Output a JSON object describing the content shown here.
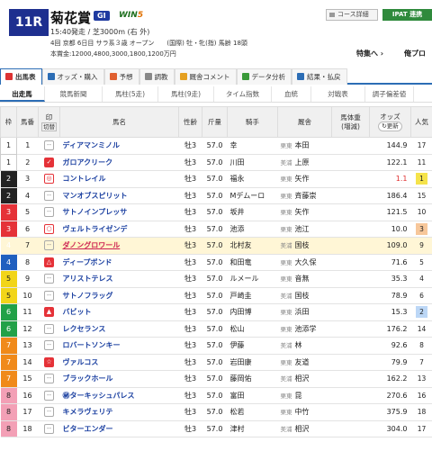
{
  "race": {
    "no": "11R",
    "name": "菊花賞",
    "grade": "GI",
    "win5_a": "WIN",
    "win5_b": "5",
    "line1": "15:40発走 / 芝3000m (右 外)",
    "line2": "4回 京都 6日目 サラ系３歳 オープン　　(国際) 牡・牝(指) 馬齢 18頭",
    "line3": "本賞金:12000,4800,3000,1800,1200万円"
  },
  "buttons": {
    "course": "コース詳細",
    "ipat": "IPAT 連携",
    "feature": "特集へ ›",
    "mypro": "俺プロ"
  },
  "tabs": [
    "出馬表",
    "オッズ・購入",
    "予想",
    "調教",
    "厩舎コメント",
    "データ分析",
    "結果・払戻"
  ],
  "subtabs": [
    "出走馬",
    "競馬新聞",
    "馬柱(5走)",
    "馬柱(9走)",
    "タイム指数",
    "血統",
    "対戦表",
    "調子偏差値"
  ],
  "header": {
    "waku": "枠",
    "umaban": "馬番",
    "mark_a": "印",
    "mark_b": "切替",
    "horse": "馬名",
    "sex": "性齢",
    "weight": "斤量",
    "jockey": "騎手",
    "stable": "厩舎",
    "bw_a": "馬体重",
    "bw_b": "(増減)",
    "odds": "オッズ",
    "odds_btn": "更新",
    "pop": "人気"
  },
  "rows": [
    {
      "w": "1",
      "u": "1",
      "mark": "",
      "name": "ディアマンミノル",
      "sex": "牡3",
      "kg": "57.0",
      "j": "幸",
      "region": "栗東",
      "st": "本田",
      "odds": "144.9",
      "pop": "17"
    },
    {
      "w": "1",
      "u": "2",
      "mark": "✓",
      "name": "ガロアクリーク",
      "sex": "牡3",
      "kg": "57.0",
      "j": "川田",
      "region": "美浦",
      "st": "上原",
      "odds": "122.1",
      "pop": "11"
    },
    {
      "w": "2",
      "u": "3",
      "mark": "◎",
      "name": "コントレイル",
      "sex": "牡3",
      "kg": "57.0",
      "j": "福永",
      "region": "栗東",
      "st": "矢作",
      "odds": "1.1",
      "pop": "1"
    },
    {
      "w": "2",
      "u": "4",
      "mark": "",
      "name": "マンオブスピリット",
      "sex": "牡3",
      "kg": "57.0",
      "j": "Mデムーロ",
      "region": "栗東",
      "st": "斉藤崇",
      "odds": "186.4",
      "pop": "15"
    },
    {
      "w": "3",
      "u": "5",
      "mark": "",
      "name": "サトノインプレッサ",
      "sex": "牡3",
      "kg": "57.0",
      "j": "坂井",
      "region": "栗東",
      "st": "矢作",
      "odds": "121.5",
      "pop": "10"
    },
    {
      "w": "3",
      "u": "6",
      "mark": "○",
      "name": "ヴェルトライゼンデ",
      "sex": "牡3",
      "kg": "57.0",
      "j": "池添",
      "region": "栗東",
      "st": "池江",
      "odds": "10.0",
      "pop": "3"
    },
    {
      "w": "4",
      "u": "7",
      "mark": "",
      "name": "ダノングロワール",
      "sex": "牡3",
      "kg": "57.0",
      "j": "北村友",
      "region": "美浦",
      "st": "国枝",
      "odds": "109.0",
      "pop": "9"
    },
    {
      "w": "4",
      "u": "8",
      "mark": "△",
      "name": "ディープボンド",
      "sex": "牡3",
      "kg": "57.0",
      "j": "和田竜",
      "region": "栗東",
      "st": "大久保",
      "odds": "71.6",
      "pop": "5"
    },
    {
      "w": "5",
      "u": "9",
      "mark": "",
      "name": "アリストテレス",
      "sex": "牡3",
      "kg": "57.0",
      "j": "ルメール",
      "region": "栗東",
      "st": "音無",
      "odds": "35.3",
      "pop": "4"
    },
    {
      "w": "5",
      "u": "10",
      "mark": "",
      "name": "サトノフラッグ",
      "sex": "牡3",
      "kg": "57.0",
      "j": "戸崎圭",
      "region": "美浦",
      "st": "国枝",
      "odds": "78.9",
      "pop": "6"
    },
    {
      "w": "6",
      "u": "11",
      "mark": "▲",
      "name": "バビット",
      "sex": "牡3",
      "kg": "57.0",
      "j": "内田博",
      "region": "栗東",
      "st": "浜田",
      "odds": "15.3",
      "pop": "2"
    },
    {
      "w": "6",
      "u": "12",
      "mark": "",
      "name": "レクセランス",
      "sex": "牡3",
      "kg": "57.0",
      "j": "松山",
      "region": "栗東",
      "st": "池添学",
      "odds": "176.2",
      "pop": "14"
    },
    {
      "w": "7",
      "u": "13",
      "mark": "",
      "name": "ロバートソンキー",
      "sex": "牡3",
      "kg": "57.0",
      "j": "伊藤",
      "region": "美浦",
      "st": "林",
      "odds": "92.6",
      "pop": "8"
    },
    {
      "w": "7",
      "u": "14",
      "mark": "☆",
      "name": "ヴァルコス",
      "sex": "牡3",
      "kg": "57.0",
      "j": "岩田康",
      "region": "栗東",
      "st": "友道",
      "odds": "79.9",
      "pop": "7"
    },
    {
      "w": "7",
      "u": "15",
      "mark": "",
      "name": "ブラックホール",
      "sex": "牡3",
      "kg": "57.0",
      "j": "藤岡佑",
      "region": "美浦",
      "st": "相沢",
      "odds": "162.2",
      "pop": "13"
    },
    {
      "w": "8",
      "u": "16",
      "mark": "",
      "name": "㊙ターキッシュパレス",
      "sex": "牡3",
      "kg": "57.0",
      "j": "富田",
      "region": "栗東",
      "st": "昆",
      "odds": "270.6",
      "pop": "16"
    },
    {
      "w": "8",
      "u": "17",
      "mark": "",
      "name": "キメラヴェリテ",
      "sex": "牡3",
      "kg": "57.0",
      "j": "松若",
      "region": "栗東",
      "st": "中竹",
      "odds": "375.9",
      "pop": "18"
    },
    {
      "w": "8",
      "u": "18",
      "mark": "",
      "name": "ビターエンダー",
      "sex": "牡3",
      "kg": "57.0",
      "j": "津村",
      "region": "美浦",
      "st": "相沢",
      "odds": "304.0",
      "pop": "17"
    }
  ]
}
